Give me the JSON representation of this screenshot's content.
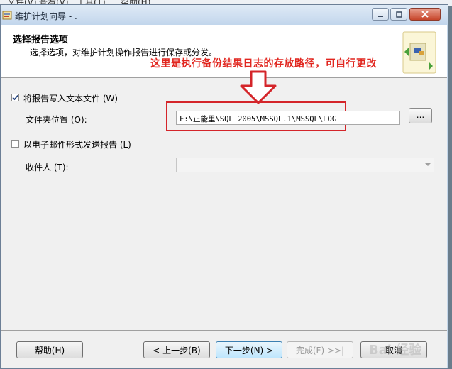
{
  "menubar": {
    "items": [
      "文件(V)",
      "查看(V)",
      "工具(T)",
      "帮助(H)"
    ]
  },
  "window": {
    "title": "维护计划向导 - .",
    "controls": {
      "minimize": "minimize-icon",
      "maximize": "maximize-icon",
      "close": "close-icon"
    }
  },
  "header": {
    "title": "选择报告选项",
    "subtitle": "选择选项，对维护计划操作报告进行保存或分发。"
  },
  "annotation": {
    "text": "这里是执行备份结果日志的存放路径，可自行更改",
    "color": "#e1261f"
  },
  "options": {
    "write_to_file": {
      "label": "将报告写入文本文件 (W)",
      "checked": true
    },
    "folder": {
      "label": "文件夹位置 (O):",
      "value": "F:\\正能里\\SQL 2005\\MSSQL.1\\MSSQL\\LOG",
      "browse_label": "..."
    },
    "email": {
      "label": "以电子邮件形式发送报告 (L)",
      "checked": false
    },
    "recipient": {
      "label": "收件人 (T):",
      "value": ""
    }
  },
  "footer": {
    "help": "帮助(H)",
    "back": "< 上一步(B)",
    "next": "下一步(N) >",
    "finish": "完成(F) >>|",
    "cancel": "取消"
  },
  "watermark": "Bai 经验"
}
